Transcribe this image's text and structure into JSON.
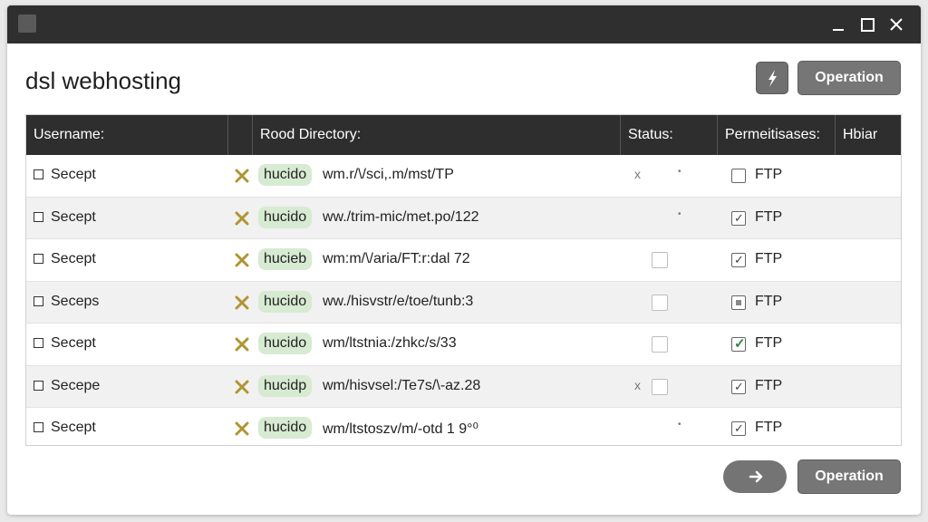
{
  "window": {
    "controls": [
      "minimize-icon",
      "maximize-icon",
      "close-icon"
    ]
  },
  "header": {
    "title": "dsl webhosting",
    "icon_button": "flash-icon",
    "operation_label": "Operation"
  },
  "table": {
    "columns": [
      "Username:",
      "",
      "Rood Directory:",
      "Status:",
      "Permeitisases:",
      "Hbiar"
    ],
    "rows": [
      {
        "username": "Secept",
        "tag": "hucido",
        "path": "wm.r/\\/sci,.m/mst/TP",
        "status": "x-dot",
        "perm_state": "unchecked",
        "perm_label": "FTP"
      },
      {
        "username": "Secept",
        "tag": "hucido",
        "path": "ww./trim-mic/met.po/122",
        "status": "dot",
        "perm_state": "checked",
        "perm_label": "FTP"
      },
      {
        "username": "Secept",
        "tag": "hucieb",
        "path": "wm:m/\\/aria/FT:r:dal 72",
        "status": "box",
        "perm_state": "checked",
        "perm_label": "FTP"
      },
      {
        "username": "Seceps",
        "tag": "hucido",
        "path": "ww./hisvstr/e/toe/tunb:3",
        "status": "box",
        "perm_state": "partial",
        "perm_label": "FTP"
      },
      {
        "username": "Secept",
        "tag": "hucido",
        "path": "wm/ltstnia:/zhkc/s/33",
        "status": "box",
        "perm_state": "checked-green",
        "perm_label": "FTP"
      },
      {
        "username": "Secepe",
        "tag": "hucidp",
        "path": "wm/hisvsel:/Te7s/\\-az.28",
        "status": "x-box",
        "perm_state": "checked",
        "perm_label": "FTP"
      },
      {
        "username": "Secept",
        "tag": "hucido",
        "path": "wm/ltstoszv/m/-otd 1 9°⁰",
        "status": "dot",
        "perm_state": "checked",
        "perm_label": "FTP"
      }
    ]
  },
  "footer": {
    "next_icon": "arrow-right-icon",
    "operation_label": "Operation"
  },
  "colors": {
    "titlebar": "#2f2f2f",
    "button": "#767676",
    "tag": "#d7ead2",
    "check_green": "#2d8a3e"
  }
}
